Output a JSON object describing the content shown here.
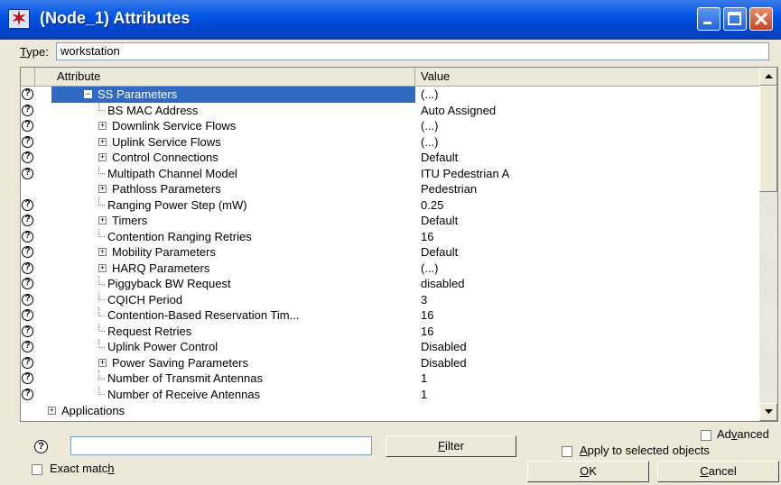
{
  "window": {
    "title": "(Node_1) Attributes",
    "titlebar_color": "#0055e5"
  },
  "type_row": {
    "label": "Type:",
    "value": "workstation"
  },
  "table": {
    "headers": {
      "attribute": "Attribute",
      "value": "Value"
    },
    "selection_color": "#316ac5",
    "rows": [
      {
        "attribute": "SS Parameters",
        "value": "(...)",
        "kind": "collapse",
        "help": true,
        "selected": true
      },
      {
        "attribute": "BS MAC Address",
        "value": "Auto Assigned",
        "kind": "leaf",
        "help": true
      },
      {
        "attribute": "Downlink Service Flows",
        "value": "(...)",
        "kind": "expand",
        "help": true
      },
      {
        "attribute": "Uplink Service Flows",
        "value": "(...)",
        "kind": "expand",
        "help": true
      },
      {
        "attribute": "Control Connections",
        "value": "Default",
        "kind": "expand",
        "help": true
      },
      {
        "attribute": "Multipath Channel Model",
        "value": "ITU Pedestrian A",
        "kind": "leaf",
        "help": true
      },
      {
        "attribute": "Pathloss Parameters",
        "value": "Pedestrian",
        "kind": "expand",
        "help": false
      },
      {
        "attribute": "Ranging Power Step (mW)",
        "value": "0.25",
        "kind": "leaf",
        "help": true
      },
      {
        "attribute": "Timers",
        "value": "Default",
        "kind": "expand",
        "help": true
      },
      {
        "attribute": "Contention Ranging Retries",
        "value": "16",
        "kind": "leaf",
        "help": true
      },
      {
        "attribute": "Mobility Parameters",
        "value": "Default",
        "kind": "expand",
        "help": true
      },
      {
        "attribute": "HARQ Parameters",
        "value": "(...)",
        "kind": "expand",
        "help": true
      },
      {
        "attribute": "Piggyback BW Request",
        "value": "disabled",
        "kind": "leaf",
        "help": true
      },
      {
        "attribute": "CQICH Period",
        "value": "3",
        "kind": "leaf",
        "help": true
      },
      {
        "attribute": "Contention-Based Reservation Tim...",
        "value": "16",
        "kind": "leaf",
        "help": true
      },
      {
        "attribute": "Request Retries",
        "value": "16",
        "kind": "leaf",
        "help": true
      },
      {
        "attribute": "Uplink Power Control",
        "value": "Disabled",
        "kind": "leaf",
        "help": true
      },
      {
        "attribute": "Power Saving Parameters",
        "value": "Disabled",
        "kind": "expand",
        "help": true
      },
      {
        "attribute": "Number of Transmit Antennas",
        "value": "1",
        "kind": "leaf",
        "help": true
      },
      {
        "attribute": "Number of Receive Antennas",
        "value": "1",
        "kind": "leaf",
        "help": true
      }
    ],
    "applications_row": "Applications",
    "help_glyph": "?",
    "expand_glyph": "+",
    "collapse_glyph": "−"
  },
  "bottom": {
    "advanced_label": "Advanced",
    "filter_button": "Filter",
    "apply_label": "Apply to selected objects",
    "exact_match_label": "Exact match",
    "ok_button": "OK",
    "cancel_button": "Cancel",
    "search_value": ""
  }
}
